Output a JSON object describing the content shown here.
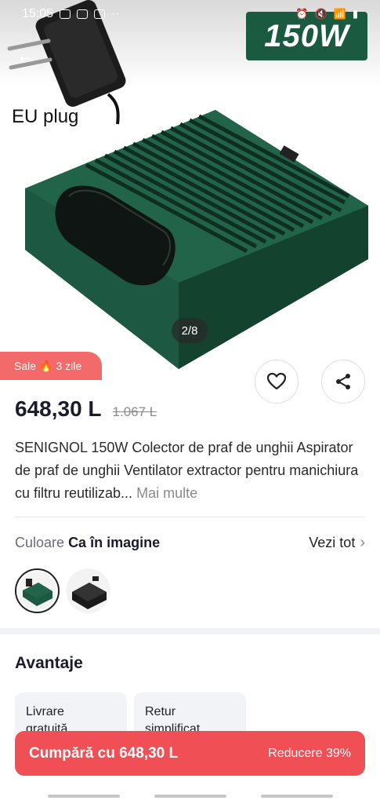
{
  "status_bar": {
    "time": "15:05",
    "extra_icons": "··"
  },
  "hero": {
    "badge": "150W",
    "plug_label": "EU plug",
    "counter": "2/8"
  },
  "sale_tag": {
    "label": "Sale",
    "emoji": "🔥",
    "days": "3 zile"
  },
  "price": {
    "current": "648,30 L",
    "original": "1.067 L"
  },
  "product": {
    "title": "SENIGNOL 150W Colector de praf de unghii Aspirator de praf de unghii Ventilator extractor pentru manichiura cu filtru reutilizab...",
    "more": "Mai multe"
  },
  "color": {
    "label": "Culoare",
    "value": "Ca în imagine",
    "see_all": "Vezi tot"
  },
  "advantages": {
    "title": "Avantaje",
    "cards": [
      {
        "line1": "Livrare",
        "line2": "gratuită"
      },
      {
        "line1": "Retur",
        "line2": "simplificat"
      }
    ]
  },
  "buy_bar": {
    "buy_label": "Cumpără cu 648,30 L",
    "discount_label": "Reducere 39%"
  },
  "colors": {
    "accent": "#f04f55",
    "product_green": "#1a5a40",
    "sale": "#f26a6a"
  }
}
